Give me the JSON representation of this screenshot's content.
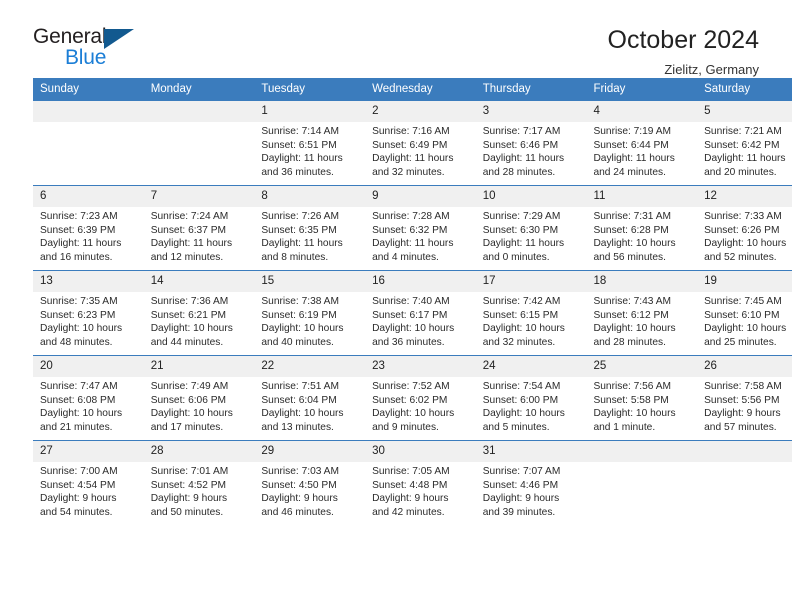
{
  "logo": {
    "word_top": "General",
    "word_bottom": "Blue",
    "triangle_icon": "blue-triangle-icon"
  },
  "header": {
    "title": "October 2024",
    "location": "Zielitz, Germany"
  },
  "colors": {
    "header_blue": "#3b7cbd",
    "daynum_band": "#f0f0f0",
    "logo_blue": "#1b7ed6",
    "logo_triangle": "#12598f",
    "text": "#222222"
  },
  "calendar": {
    "weekday_headers": [
      "Sunday",
      "Monday",
      "Tuesday",
      "Wednesday",
      "Thursday",
      "Friday",
      "Saturday"
    ],
    "labels": {
      "sunrise": "Sunrise:",
      "sunset": "Sunset:",
      "daylight": "Daylight:"
    },
    "weeks": [
      [
        {
          "day": "",
          "empty": true
        },
        {
          "day": "",
          "empty": true
        },
        {
          "day": "1",
          "sunrise": "Sunrise: 7:14 AM",
          "sunset": "Sunset: 6:51 PM",
          "daylight1": "Daylight: 11 hours",
          "daylight2": "and 36 minutes."
        },
        {
          "day": "2",
          "sunrise": "Sunrise: 7:16 AM",
          "sunset": "Sunset: 6:49 PM",
          "daylight1": "Daylight: 11 hours",
          "daylight2": "and 32 minutes."
        },
        {
          "day": "3",
          "sunrise": "Sunrise: 7:17 AM",
          "sunset": "Sunset: 6:46 PM",
          "daylight1": "Daylight: 11 hours",
          "daylight2": "and 28 minutes."
        },
        {
          "day": "4",
          "sunrise": "Sunrise: 7:19 AM",
          "sunset": "Sunset: 6:44 PM",
          "daylight1": "Daylight: 11 hours",
          "daylight2": "and 24 minutes."
        },
        {
          "day": "5",
          "sunrise": "Sunrise: 7:21 AM",
          "sunset": "Sunset: 6:42 PM",
          "daylight1": "Daylight: 11 hours",
          "daylight2": "and 20 minutes."
        }
      ],
      [
        {
          "day": "6",
          "sunrise": "Sunrise: 7:23 AM",
          "sunset": "Sunset: 6:39 PM",
          "daylight1": "Daylight: 11 hours",
          "daylight2": "and 16 minutes."
        },
        {
          "day": "7",
          "sunrise": "Sunrise: 7:24 AM",
          "sunset": "Sunset: 6:37 PM",
          "daylight1": "Daylight: 11 hours",
          "daylight2": "and 12 minutes."
        },
        {
          "day": "8",
          "sunrise": "Sunrise: 7:26 AM",
          "sunset": "Sunset: 6:35 PM",
          "daylight1": "Daylight: 11 hours",
          "daylight2": "and 8 minutes."
        },
        {
          "day": "9",
          "sunrise": "Sunrise: 7:28 AM",
          "sunset": "Sunset: 6:32 PM",
          "daylight1": "Daylight: 11 hours",
          "daylight2": "and 4 minutes."
        },
        {
          "day": "10",
          "sunrise": "Sunrise: 7:29 AM",
          "sunset": "Sunset: 6:30 PM",
          "daylight1": "Daylight: 11 hours",
          "daylight2": "and 0 minutes."
        },
        {
          "day": "11",
          "sunrise": "Sunrise: 7:31 AM",
          "sunset": "Sunset: 6:28 PM",
          "daylight1": "Daylight: 10 hours",
          "daylight2": "and 56 minutes."
        },
        {
          "day": "12",
          "sunrise": "Sunrise: 7:33 AM",
          "sunset": "Sunset: 6:26 PM",
          "daylight1": "Daylight: 10 hours",
          "daylight2": "and 52 minutes."
        }
      ],
      [
        {
          "day": "13",
          "sunrise": "Sunrise: 7:35 AM",
          "sunset": "Sunset: 6:23 PM",
          "daylight1": "Daylight: 10 hours",
          "daylight2": "and 48 minutes."
        },
        {
          "day": "14",
          "sunrise": "Sunrise: 7:36 AM",
          "sunset": "Sunset: 6:21 PM",
          "daylight1": "Daylight: 10 hours",
          "daylight2": "and 44 minutes."
        },
        {
          "day": "15",
          "sunrise": "Sunrise: 7:38 AM",
          "sunset": "Sunset: 6:19 PM",
          "daylight1": "Daylight: 10 hours",
          "daylight2": "and 40 minutes."
        },
        {
          "day": "16",
          "sunrise": "Sunrise: 7:40 AM",
          "sunset": "Sunset: 6:17 PM",
          "daylight1": "Daylight: 10 hours",
          "daylight2": "and 36 minutes."
        },
        {
          "day": "17",
          "sunrise": "Sunrise: 7:42 AM",
          "sunset": "Sunset: 6:15 PM",
          "daylight1": "Daylight: 10 hours",
          "daylight2": "and 32 minutes."
        },
        {
          "day": "18",
          "sunrise": "Sunrise: 7:43 AM",
          "sunset": "Sunset: 6:12 PM",
          "daylight1": "Daylight: 10 hours",
          "daylight2": "and 28 minutes."
        },
        {
          "day": "19",
          "sunrise": "Sunrise: 7:45 AM",
          "sunset": "Sunset: 6:10 PM",
          "daylight1": "Daylight: 10 hours",
          "daylight2": "and 25 minutes."
        }
      ],
      [
        {
          "day": "20",
          "sunrise": "Sunrise: 7:47 AM",
          "sunset": "Sunset: 6:08 PM",
          "daylight1": "Daylight: 10 hours",
          "daylight2": "and 21 minutes."
        },
        {
          "day": "21",
          "sunrise": "Sunrise: 7:49 AM",
          "sunset": "Sunset: 6:06 PM",
          "daylight1": "Daylight: 10 hours",
          "daylight2": "and 17 minutes."
        },
        {
          "day": "22",
          "sunrise": "Sunrise: 7:51 AM",
          "sunset": "Sunset: 6:04 PM",
          "daylight1": "Daylight: 10 hours",
          "daylight2": "and 13 minutes."
        },
        {
          "day": "23",
          "sunrise": "Sunrise: 7:52 AM",
          "sunset": "Sunset: 6:02 PM",
          "daylight1": "Daylight: 10 hours",
          "daylight2": "and 9 minutes."
        },
        {
          "day": "24",
          "sunrise": "Sunrise: 7:54 AM",
          "sunset": "Sunset: 6:00 PM",
          "daylight1": "Daylight: 10 hours",
          "daylight2": "and 5 minutes."
        },
        {
          "day": "25",
          "sunrise": "Sunrise: 7:56 AM",
          "sunset": "Sunset: 5:58 PM",
          "daylight1": "Daylight: 10 hours",
          "daylight2": "and 1 minute."
        },
        {
          "day": "26",
          "sunrise": "Sunrise: 7:58 AM",
          "sunset": "Sunset: 5:56 PM",
          "daylight1": "Daylight: 9 hours",
          "daylight2": "and 57 minutes."
        }
      ],
      [
        {
          "day": "27",
          "sunrise": "Sunrise: 7:00 AM",
          "sunset": "Sunset: 4:54 PM",
          "daylight1": "Daylight: 9 hours",
          "daylight2": "and 54 minutes."
        },
        {
          "day": "28",
          "sunrise": "Sunrise: 7:01 AM",
          "sunset": "Sunset: 4:52 PM",
          "daylight1": "Daylight: 9 hours",
          "daylight2": "and 50 minutes."
        },
        {
          "day": "29",
          "sunrise": "Sunrise: 7:03 AM",
          "sunset": "Sunset: 4:50 PM",
          "daylight1": "Daylight: 9 hours",
          "daylight2": "and 46 minutes."
        },
        {
          "day": "30",
          "sunrise": "Sunrise: 7:05 AM",
          "sunset": "Sunset: 4:48 PM",
          "daylight1": "Daylight: 9 hours",
          "daylight2": "and 42 minutes."
        },
        {
          "day": "31",
          "sunrise": "Sunrise: 7:07 AM",
          "sunset": "Sunset: 4:46 PM",
          "daylight1": "Daylight: 9 hours",
          "daylight2": "and 39 minutes."
        },
        {
          "day": "",
          "empty": true
        },
        {
          "day": "",
          "empty": true
        }
      ]
    ]
  }
}
